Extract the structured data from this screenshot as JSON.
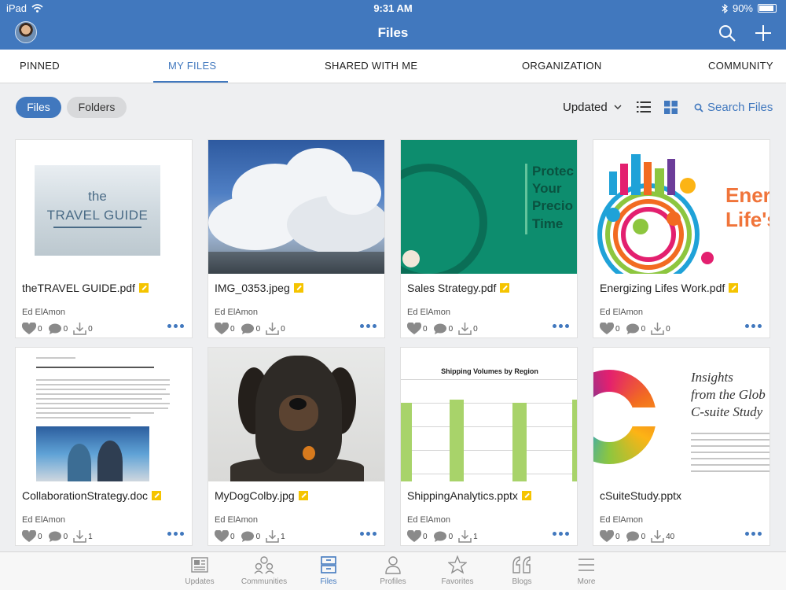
{
  "status": {
    "device": "iPad",
    "time": "9:31 AM",
    "battery": "90%",
    "battery_level": 0.9
  },
  "header": {
    "title": "Files"
  },
  "tabs": [
    {
      "label": "PINNED",
      "active": false
    },
    {
      "label": "MY FILES",
      "active": true
    },
    {
      "label": "SHARED WITH ME",
      "active": false
    },
    {
      "label": "ORGANIZATION",
      "active": false
    },
    {
      "label": "COMMUNITY",
      "active": false
    }
  ],
  "toolbar": {
    "files_label": "Files",
    "folders_label": "Folders",
    "sort_label": "Updated",
    "search_label": "Search Files"
  },
  "files": [
    {
      "name": "theTRAVEL GUIDE.pdf",
      "author": "Ed ElAmon",
      "likes": "0",
      "comments": "0",
      "downloads": "0"
    },
    {
      "name": "IMG_0353.jpeg",
      "author": "Ed ElAmon",
      "likes": "0",
      "comments": "0",
      "downloads": "0"
    },
    {
      "name": "Sales Strategy.pdf",
      "author": "Ed ElAmon",
      "likes": "0",
      "comments": "0",
      "downloads": "0"
    },
    {
      "name": "Energizing Lifes Work.pdf",
      "author": "Ed ElAmon",
      "likes": "0",
      "comments": "0",
      "downloads": "0"
    },
    {
      "name": "CollaborationStrategy.doc",
      "author": "Ed ElAmon",
      "likes": "0",
      "comments": "0",
      "downloads": "1"
    },
    {
      "name": "MyDogColby.jpg",
      "author": "Ed ElAmon",
      "likes": "0",
      "comments": "0",
      "downloads": "1"
    },
    {
      "name": "ShippingAnalytics.pptx",
      "author": "Ed ElAmon",
      "likes": "0",
      "comments": "0",
      "downloads": "1"
    },
    {
      "name": "cSuiteStudy.pptx",
      "author": "Ed ElAmon",
      "likes": "0",
      "comments": "0",
      "downloads": "40"
    }
  ],
  "thumbnails": {
    "travel": {
      "line1": "the",
      "line2": "TRAVEL GUIDE"
    },
    "sales": {
      "line1": "Protec",
      "line2": "Your",
      "line3": "Precio",
      "line4": "Time"
    },
    "energy": {
      "line1": "Ener",
      "line2": "Life's"
    },
    "shipping": {
      "title": "Shipping Volumes by Region"
    },
    "csuite": {
      "line1": "Insights",
      "line2": "from the Glob",
      "line3": "C-suite Study"
    }
  },
  "bottom_nav": [
    {
      "label": "Updates",
      "icon": "updates-icon",
      "active": false
    },
    {
      "label": "Communities",
      "icon": "communities-icon",
      "active": false
    },
    {
      "label": "Files",
      "icon": "files-icon",
      "active": true
    },
    {
      "label": "Profiles",
      "icon": "profiles-icon",
      "active": false
    },
    {
      "label": "Favorites",
      "icon": "favorites-icon",
      "active": false
    },
    {
      "label": "Blogs",
      "icon": "blogs-icon",
      "active": false
    },
    {
      "label": "More",
      "icon": "more-icon",
      "active": false
    }
  ],
  "colors": {
    "brand": "#4178be",
    "accent_badge": "#f5c400"
  }
}
